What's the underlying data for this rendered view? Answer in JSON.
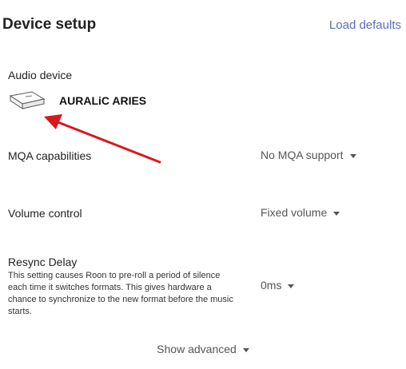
{
  "header": {
    "title": "Device setup",
    "load_defaults": "Load defaults"
  },
  "audio_device": {
    "label": "Audio device",
    "name": "AURALiC ARIES",
    "image_icon": "device-box-icon"
  },
  "mqa": {
    "label": "MQA capabilities",
    "value": "No MQA support"
  },
  "volume": {
    "label": "Volume control",
    "value": "Fixed volume"
  },
  "resync": {
    "label": "Resync Delay",
    "description": "This setting causes Roon to pre-roll a period of silence each time it switches formats. This gives hardware a chance to synchronize to the new format before the music starts.",
    "value": "0ms"
  },
  "footer": {
    "show_advanced": "Show advanced"
  },
  "colors": {
    "link": "#5b6fb3",
    "annotation_arrow": "#d9181e"
  }
}
